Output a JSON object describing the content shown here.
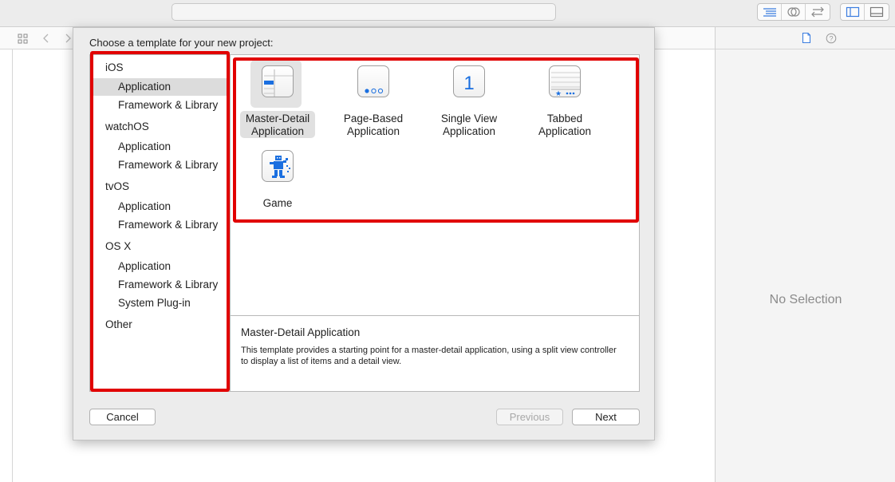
{
  "inspector": {
    "no_selection": "No Selection"
  },
  "dialog": {
    "title": "Choose a template for your new project:",
    "sidebar": [
      {
        "type": "category",
        "label": "iOS"
      },
      {
        "type": "item",
        "label": "Application",
        "selected": true
      },
      {
        "type": "item",
        "label": "Framework & Library"
      },
      {
        "type": "category",
        "label": "watchOS"
      },
      {
        "type": "item",
        "label": "Application"
      },
      {
        "type": "item",
        "label": "Framework & Library"
      },
      {
        "type": "category",
        "label": "tvOS"
      },
      {
        "type": "item",
        "label": "Application"
      },
      {
        "type": "item",
        "label": "Framework & Library"
      },
      {
        "type": "category",
        "label": "OS X"
      },
      {
        "type": "item",
        "label": "Application"
      },
      {
        "type": "item",
        "label": "Framework & Library"
      },
      {
        "type": "item",
        "label": "System Plug-in"
      },
      {
        "type": "category",
        "label": "Other"
      }
    ],
    "templates": [
      {
        "line1": "Master-Detail",
        "line2": "Application",
        "icon": "master-detail-icon",
        "selected": true
      },
      {
        "line1": "Page-Based",
        "line2": "Application",
        "icon": "page-based-icon"
      },
      {
        "line1": "Single View",
        "line2": "Application",
        "icon": "single-view-icon",
        "glyph": "1"
      },
      {
        "line1": "Tabbed",
        "line2": "Application",
        "icon": "tabbed-icon"
      },
      {
        "line1": "Game",
        "line2": "",
        "icon": "game-icon"
      }
    ],
    "description": {
      "title": "Master-Detail Application",
      "text": "This template provides a starting point for a master-detail application, using a split view controller to display a list of items and a detail view."
    },
    "buttons": {
      "cancel": "Cancel",
      "previous": "Previous",
      "next": "Next"
    }
  },
  "colors": {
    "accent": "#1a6fe0",
    "annotation": "#e10000"
  }
}
